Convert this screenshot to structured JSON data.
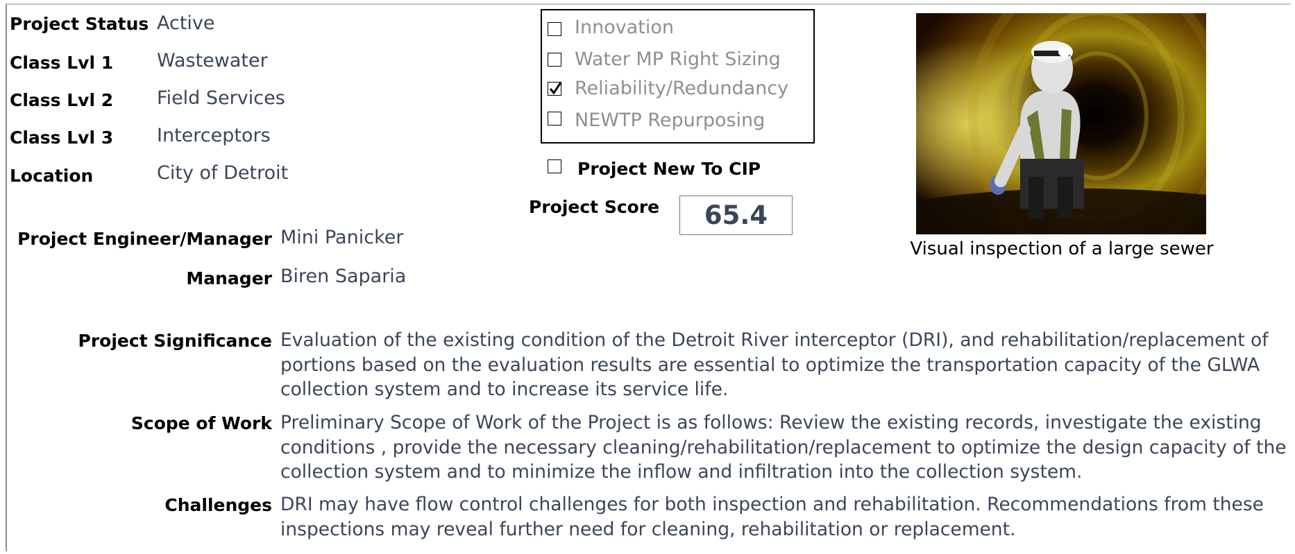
{
  "info": {
    "project_status": {
      "label": "Project Status",
      "value": "Active"
    },
    "class_lvl_1": {
      "label": "Class Lvl 1",
      "value": "Wastewater"
    },
    "class_lvl_2": {
      "label": "Class Lvl 2",
      "value": "Field Services"
    },
    "class_lvl_3": {
      "label": "Class Lvl 3",
      "value": "Interceptors"
    },
    "location": {
      "label": "Location",
      "value": "City of Detroit"
    }
  },
  "people": {
    "engineer": {
      "label": "Project Engineer/Manager",
      "value": "Mini Panicker"
    },
    "manager": {
      "label": "Manager",
      "value": "Biren Saparia"
    }
  },
  "categories": [
    {
      "label": "Innovation",
      "checked": false
    },
    {
      "label": "Water MP Right Sizing",
      "checked": false
    },
    {
      "label": "Reliability/Redundancy",
      "checked": true
    },
    {
      "label": "NEWTP Repurposing",
      "checked": false
    }
  ],
  "new_to_cip": {
    "label": "Project New To CIP",
    "checked": false
  },
  "score": {
    "label": "Project Score",
    "value": "65.4"
  },
  "photo": {
    "caption": "Visual inspection of a large sewer"
  },
  "details": {
    "significance": {
      "label": "Project Significance",
      "text": "Evaluation of the existing condition of the Detroit River interceptor (DRI), and rehabilitation/replacement of portions based on the evaluation results are essential to optimize the transportation capacity of the GLWA collection system and to increase its service life."
    },
    "scope": {
      "label": "Scope of Work",
      "text": "Preliminary Scope of Work of the Project is as follows: Review the existing records, investigate the existing conditions , provide the necessary cleaning/rehabilitation/replacement to optimize the design capacity of the collection system and to  minimize the  inflow and infiltration into the collection system."
    },
    "challenges": {
      "label": "Challenges",
      "text": "DRI may have flow control challenges for both inspection and rehabilitation. Recommendations from these inspections may reveal further need for cleaning, rehabilitation or replacement."
    }
  }
}
